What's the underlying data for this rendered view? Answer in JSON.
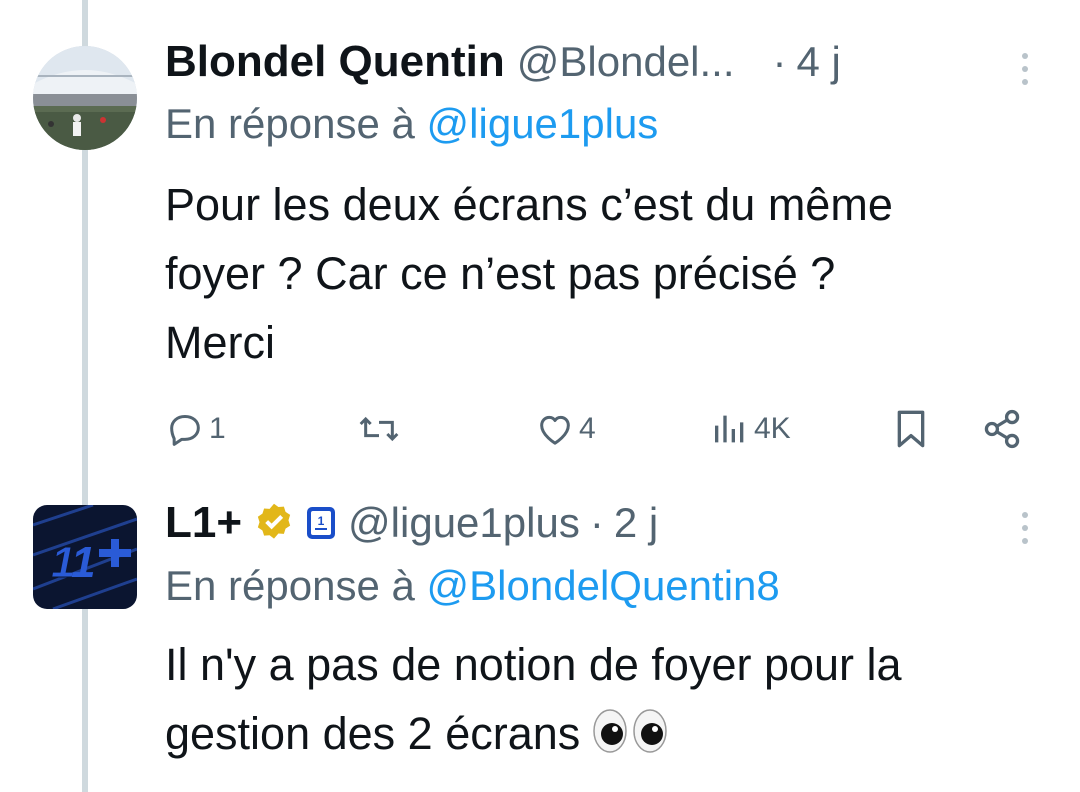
{
  "tweets": [
    {
      "name": "Blondel Quentin",
      "handle": "@Blondel...",
      "separator": "·",
      "time": "4 j",
      "reply_prefix": "En réponse à",
      "reply_handle": "@ligue1plus",
      "text_lines": [
        "Pour les deux écrans c’est du même",
        "foyer ? Car ce n’est pas précisé ?",
        "Merci"
      ],
      "actions": {
        "replies": "1",
        "retweets": "",
        "likes": "4",
        "views": "4K"
      }
    },
    {
      "name": "L1+",
      "handle": "@ligue1plus",
      "separator": "·",
      "time": "2 j",
      "reply_prefix": "En réponse à",
      "reply_handle": "@BlondelQuentin8",
      "text_lines": [
        "Il n'y a pas de notion de foyer pour la",
        "gestion des 2 écrans"
      ],
      "verified": true,
      "affiliate_badge": "ligue1-logo"
    }
  ],
  "colors": {
    "text": "#0f1419",
    "secondary": "#536471",
    "link": "#1d9bf0",
    "verified_gold": "#e2b719",
    "thread_line": "#cfd9de"
  }
}
